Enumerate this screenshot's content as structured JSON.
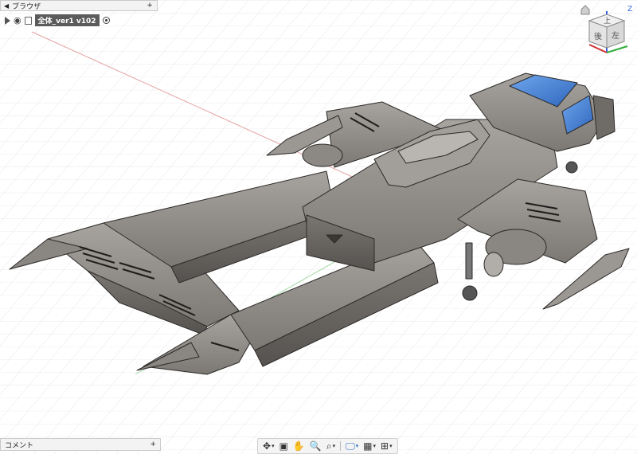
{
  "browser": {
    "title": "ブラウザ",
    "collapse_arrow": "◀",
    "pin_button": "+",
    "component_name": "全体_ver1 v102"
  },
  "comment_panel": {
    "title": "コメント",
    "add_button": "+"
  },
  "viewcube": {
    "axis_z": "Z",
    "face_top": "上",
    "face_front": "後",
    "face_right": "左",
    "x_color": "#d03030",
    "y_color": "#2fae3a",
    "z_color": "#2c5cdc"
  },
  "toolbar": {
    "items": [
      {
        "icon": "orbit-icon",
        "glyph": "✥"
      },
      {
        "icon": "look-at-icon",
        "glyph": "▣"
      },
      {
        "icon": "pan-icon",
        "glyph": "✋"
      },
      {
        "icon": "zoom-icon",
        "glyph": "🔍"
      },
      {
        "icon": "fit-icon",
        "glyph": "⌕"
      },
      {
        "icon": "display-settings-icon",
        "glyph": "🖵"
      },
      {
        "icon": "grid-icon",
        "glyph": "▦"
      },
      {
        "icon": "viewports-icon",
        "glyph": "⊞"
      }
    ]
  },
  "colors": {
    "grid_line": "#e2e2e2",
    "grid_major": "#cfcfcf",
    "body_fill": "#8f8b86",
    "body_dark": "#5e5b58",
    "edge": "#2c2a28",
    "glass": "#4a86d8"
  }
}
